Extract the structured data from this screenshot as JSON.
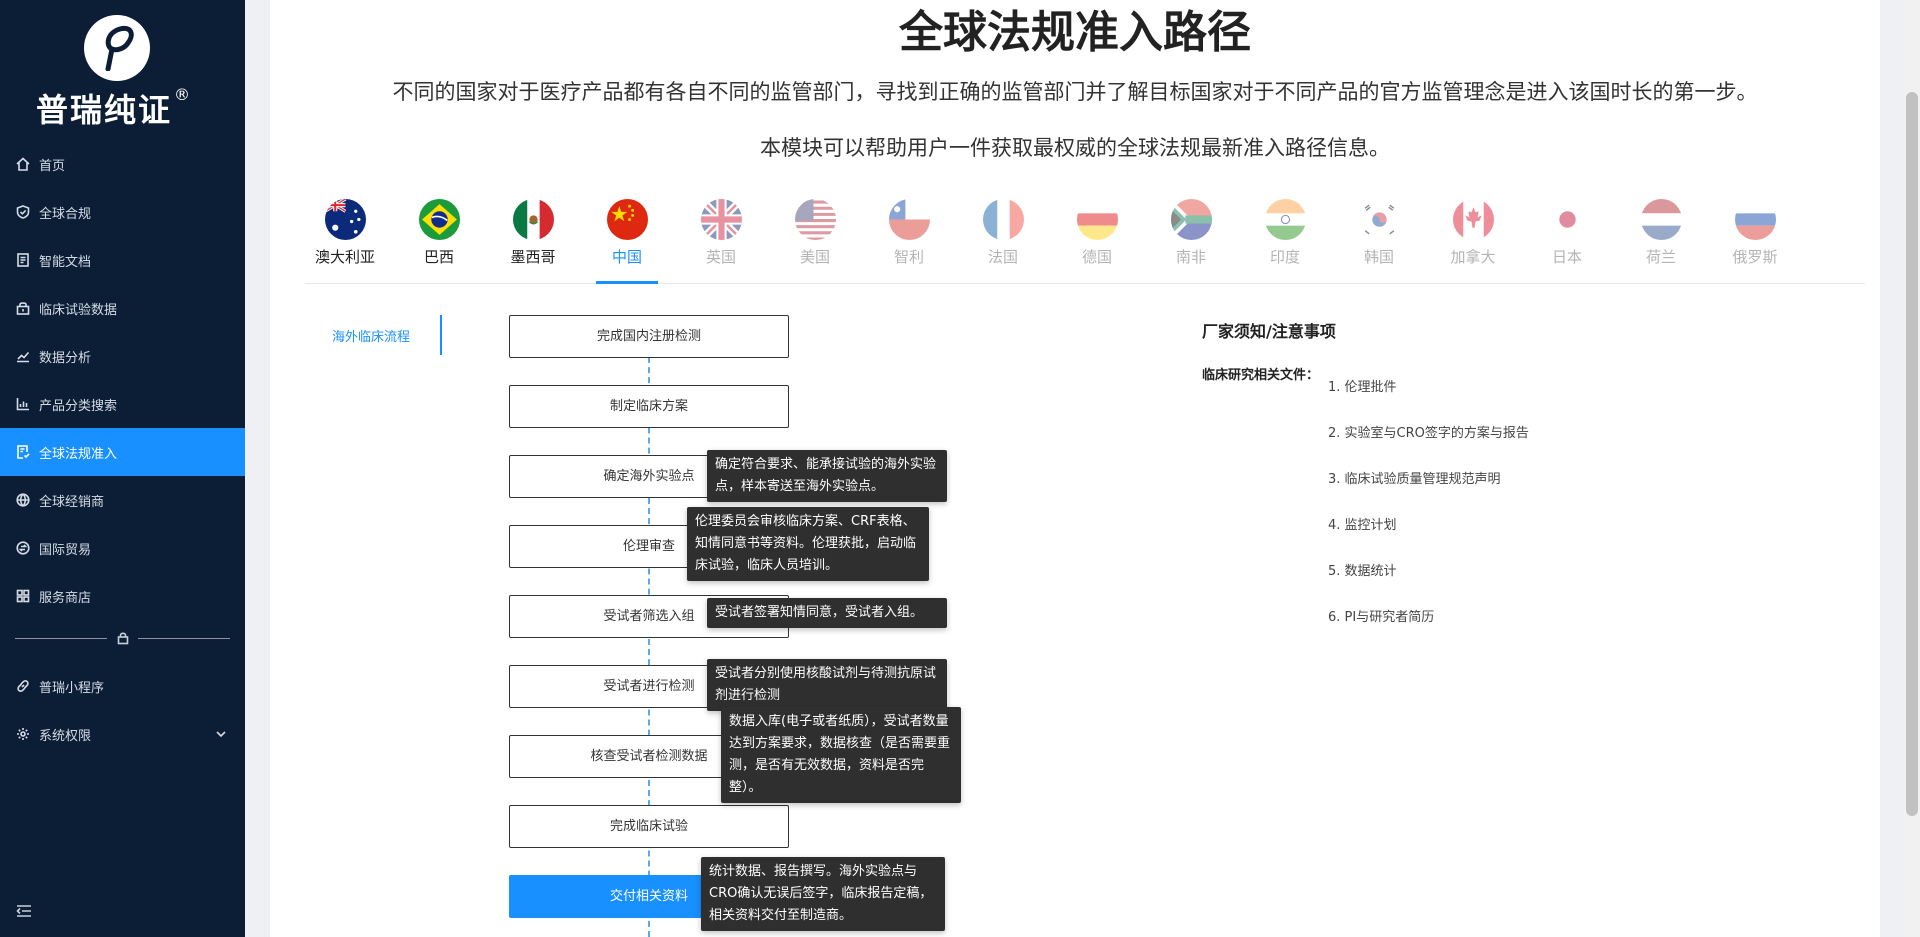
{
  "sidebar": {
    "brand": "普瑞纯证",
    "brand_reg": "®",
    "items": [
      {
        "label": "首页",
        "icon": "home-icon"
      },
      {
        "label": "全球合规",
        "icon": "shield-icon"
      },
      {
        "label": "智能文档",
        "icon": "document-icon"
      },
      {
        "label": "临床试验数据",
        "icon": "lock-box-icon"
      },
      {
        "label": "数据分析",
        "icon": "line-chart-icon"
      },
      {
        "label": "产品分类搜索",
        "icon": "bar-chart-icon"
      },
      {
        "label": "全球法规准入",
        "icon": "file-check-icon",
        "active": true
      },
      {
        "label": "全球经销商",
        "icon": "globe-icon"
      },
      {
        "label": "国际贸易",
        "icon": "trade-icon"
      },
      {
        "label": "服务商店",
        "icon": "grid-icon"
      },
      {
        "label": "普瑞小程序",
        "icon": "link-icon"
      },
      {
        "label": "系统权限",
        "icon": "gear-icon"
      }
    ]
  },
  "header": {
    "title": "全球法规准入路径",
    "desc1": "不同的国家对于医疗产品都有各自不同的监管部门，寻找到正确的监管部门并了解目标国家对于不同产品的官方监管理念是进入该国时长的第一步。",
    "desc2": "本模块可以帮助用户一件获取最权威的全球法规最新准入路径信息。"
  },
  "countries": [
    {
      "name": "澳大利亚",
      "state": "normal"
    },
    {
      "name": "巴西",
      "state": "normal"
    },
    {
      "name": "墨西哥",
      "state": "normal"
    },
    {
      "name": "中国",
      "state": "active"
    },
    {
      "name": "英国",
      "state": "faded"
    },
    {
      "name": "美国",
      "state": "faded"
    },
    {
      "name": "智利",
      "state": "faded"
    },
    {
      "name": "法国",
      "state": "faded"
    },
    {
      "name": "德国",
      "state": "faded"
    },
    {
      "name": "南非",
      "state": "faded"
    },
    {
      "name": "印度",
      "state": "faded"
    },
    {
      "name": "韩国",
      "state": "faded"
    },
    {
      "name": "加拿大",
      "state": "faded"
    },
    {
      "name": "日本",
      "state": "faded"
    },
    {
      "name": "荷兰",
      "state": "faded"
    },
    {
      "name": "俄罗斯",
      "state": "faded"
    }
  ],
  "left_tab": "海外临床流程",
  "flow": {
    "steps": [
      "完成国内注册检测",
      "制定临床方案",
      "确定海外实验点",
      "伦理审查",
      "受试者筛选入组",
      "受试者进行检测",
      "核查受试者检测数据",
      "完成临床试验",
      "交付相关资料"
    ],
    "tooltips": [
      "确定符合要求、能承接试验的海外实验点，样本寄送至海外实验点。",
      "伦理委员会审核临床方案、CRF表格、知情同意书等资料。伦理获批，启动临床试验，临床人员培训。",
      "受试者签署知情同意，受试者入组。",
      "受试者分别使用核酸试剂与待测抗原试剂进行检测",
      "数据入库(电子或者纸质），受试者数量达到方案要求，数据核查（是否需要重测，是否有无效数据，资料是否完整）。",
      "统计数据、报告撰写。海外实验点与CRO确认无误后签字，临床报告定稿，相关资料交付至制造商。"
    ]
  },
  "notes": {
    "title": "厂家须知/注意事项",
    "label": "临床研究相关文件：",
    "items": [
      "1. 伦理批件",
      "2. 实验室与CRO签字的方案与报告",
      "3. 临床试验质量管理规范声明",
      "4. 监控计划",
      "5. 数据统计",
      "6. PI与研究者简历"
    ]
  }
}
